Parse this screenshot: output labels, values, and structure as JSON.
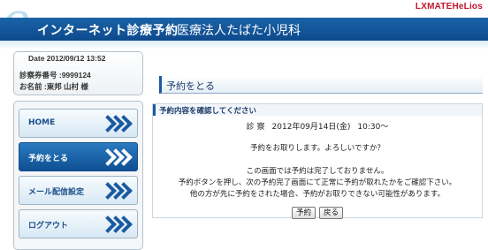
{
  "header": {
    "logo_letter": "e",
    "brand": "LXMATEHeLios",
    "app_title": "インターネット診療予約",
    "clinic_name": "医療法人たばた小児科"
  },
  "info": {
    "date": "Date 2012/09/12 13:52",
    "card_number": "診察券番号 :9999124",
    "name": "お名前 :東邦 山村 様"
  },
  "nav": {
    "items": [
      {
        "label": "HOME",
        "active": false
      },
      {
        "label": "予約をとる",
        "active": true
      },
      {
        "label": "メール配信設定",
        "active": false
      },
      {
        "label": "ログアウト",
        "active": false
      }
    ]
  },
  "main": {
    "section_title": "予約をとる",
    "panel_title": "予約内容を確認してください",
    "exam_type": "診 察",
    "exam_date": "2012年09月14日(金)",
    "exam_time": "10:30～",
    "question": "予約をお取りします。よろしいですか？",
    "notes": [
      "この画面では予約は完了しておりません。",
      "予約ボタンを押し、次の予約完了画面にて正常に予約が取れたかをご確認下さい。",
      "他の方が先に予約をされた場合、予約がお取りできない可能性があります。"
    ],
    "reserve_button": "予約",
    "back_button": "戻る"
  },
  "colors": {
    "title_bar": "#1b62a7",
    "brand": "#c0152c",
    "nav_active": "#0e4f92"
  }
}
